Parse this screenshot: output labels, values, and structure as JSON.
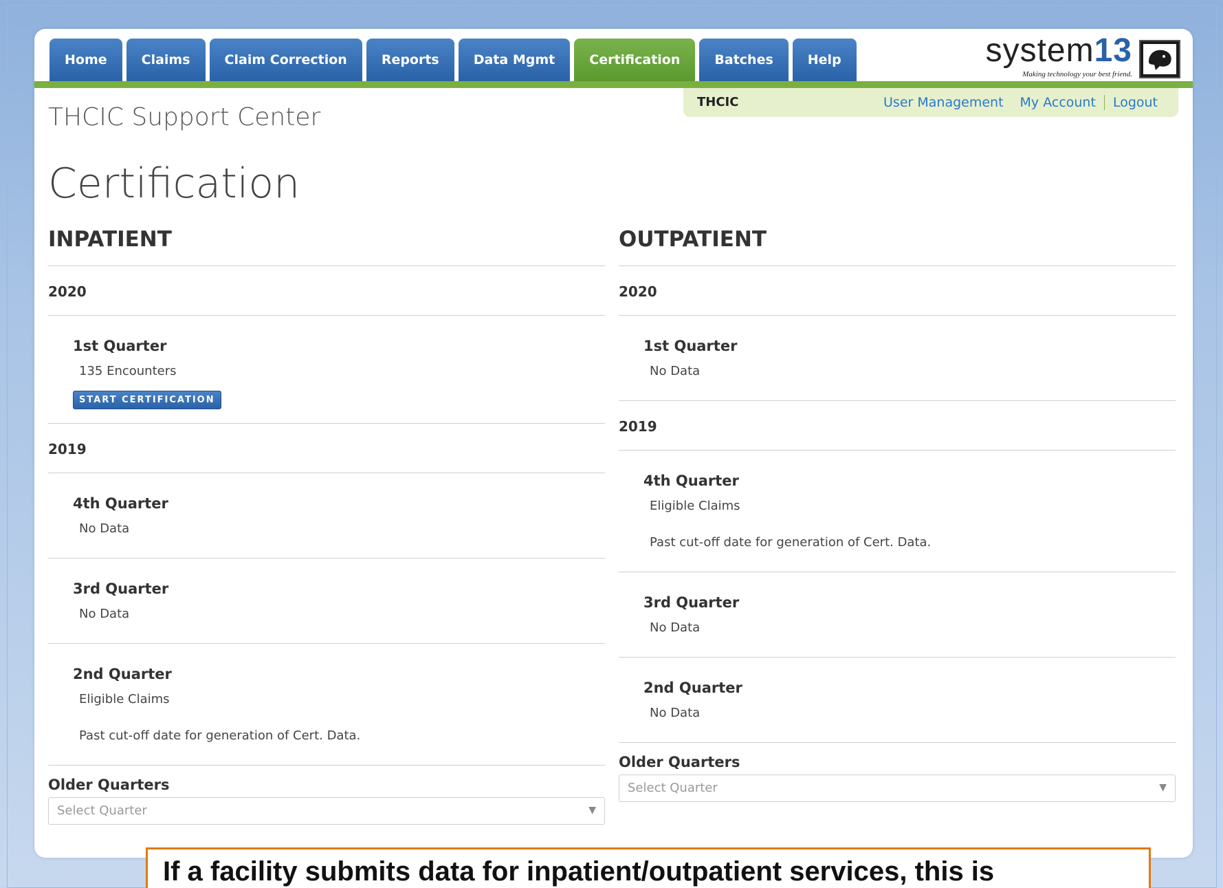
{
  "nav": {
    "tabs": [
      {
        "label": "Home"
      },
      {
        "label": "Claims"
      },
      {
        "label": "Claim Correction"
      },
      {
        "label": "Reports"
      },
      {
        "label": "Data Mgmt"
      },
      {
        "label": "Certification",
        "active": true
      },
      {
        "label": "Batches"
      },
      {
        "label": "Help"
      }
    ]
  },
  "logo": {
    "brand": "system",
    "brand_num": "13",
    "tagline": "Making technology your best friend."
  },
  "subbar": {
    "org": "THCIC",
    "user_management": "User Management",
    "my_account": "My Account",
    "logout": "Logout"
  },
  "site_title": "THCIC Support Center",
  "page_title": "Certification",
  "inpatient": {
    "heading": "INPATIENT",
    "y2020": "2020",
    "q2020_1": {
      "title": "1st Quarter",
      "text": "135 Encounters",
      "button": "START CERTIFICATION"
    },
    "y2019": "2019",
    "q2019_4": {
      "title": "4th Quarter",
      "text": "No Data"
    },
    "q2019_3": {
      "title": "3rd Quarter",
      "text": "No Data"
    },
    "q2019_2": {
      "title": "2nd Quarter",
      "text": "Eligible Claims",
      "note": "Past cut-off date for generation of Cert. Data."
    },
    "older_label": "Older Quarters",
    "select_placeholder": "Select Quarter"
  },
  "outpatient": {
    "heading": "OUTPATIENT",
    "y2020": "2020",
    "q2020_1": {
      "title": "1st Quarter",
      "text": "No Data"
    },
    "y2019": "2019",
    "q2019_4": {
      "title": "4th Quarter",
      "text": "Eligible Claims",
      "note": "Past cut-off date for generation of Cert. Data."
    },
    "q2019_3": {
      "title": "3rd Quarter",
      "text": "No Data"
    },
    "q2019_2": {
      "title": "2nd Quarter",
      "text": "No Data"
    },
    "older_label": "Older Quarters",
    "select_placeholder": "Select Quarter"
  },
  "callout": "If a facility submits data for inpatient/outpatient services, this is",
  "colors": {
    "nav_blue": "#2a62a8",
    "active_green": "#5b9a2e",
    "link_blue": "#2a7ac8",
    "callout_border": "#e07a10"
  }
}
